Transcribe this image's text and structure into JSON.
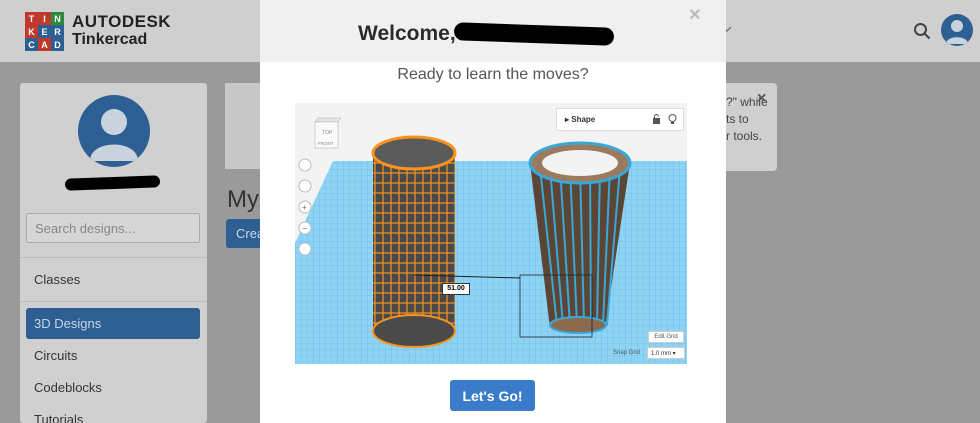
{
  "header": {
    "logo_letters": [
      "T",
      "I",
      "N",
      "K",
      "E",
      "R",
      "C",
      "A",
      "D"
    ],
    "logo_colors": [
      "#c0392b",
      "#c0392b",
      "#2b8a3e",
      "#c0392b",
      "#2d5f93",
      "#2d5f93",
      "#2d5f93",
      "#c0392b",
      "#2d5f93"
    ],
    "brand_line1": "AUTODESK",
    "brand_line2": "Tinkercad"
  },
  "sidebar": {
    "search_placeholder": "Search designs...",
    "items": [
      "Classes",
      "3D Designs",
      "Circuits",
      "Codeblocks",
      "Tutorials"
    ],
    "active_item": "3D Designs"
  },
  "main": {
    "title_partial": "My",
    "create_partial": "Crea"
  },
  "notice": {
    "lines": [
      "?\" while",
      "ts to",
      "r tools."
    ]
  },
  "modal": {
    "title": "Welcome,",
    "subtitle": "Ready to learn the moves?",
    "button_label": "Let's Go!",
    "close_symbol": "×",
    "preview": {
      "shape_label": "Shape",
      "cube_top": "TOP",
      "cube_front": "FRONT",
      "dimension": "51.00",
      "edit_grid": "Edit Grid",
      "snap_grid_label": "Snap Grid",
      "snap_grid_value": "1.0 mm ▾"
    }
  },
  "colors": {
    "accent": "#3a7cc9",
    "sidebar_active": "#2d5f93",
    "workplane": "#8fd3f4",
    "orange_object": "#f7931e",
    "brown_object": "#8b6a4f"
  }
}
